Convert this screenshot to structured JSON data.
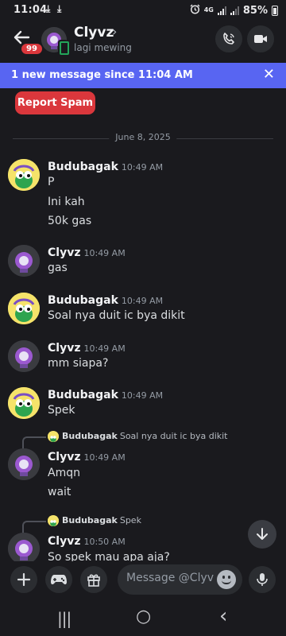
{
  "status": {
    "time": "11:04",
    "downloads": [
      "⤓",
      "⤓"
    ],
    "network": "4G",
    "battery": "85%"
  },
  "header": {
    "back_badge": "99",
    "name": "Clyvz",
    "chevron": "›",
    "subtitle": "lagi mewing",
    "call_icon": "phone-icon",
    "video_icon": "video-icon"
  },
  "banner": {
    "text": "1 new message since 11:04 AM",
    "close": "✕"
  },
  "report_spam": "Report Spam",
  "date_divider": "June 8, 2025",
  "messages": [
    {
      "author": "Budubagak",
      "time": "10:49 AM",
      "lines": [
        "P",
        "Ini kah",
        "50k gas"
      ]
    },
    {
      "author": "Clyvz",
      "time": "10:49 AM",
      "lines": [
        "gas"
      ]
    },
    {
      "author": "Budubagak",
      "time": "10:49 AM",
      "lines": [
        "Soal nya duit ic bya dikit"
      ]
    },
    {
      "author": "Clyvz",
      "time": "10:49 AM",
      "lines": [
        "mm siapa?"
      ]
    },
    {
      "author": "Budubagak",
      "time": "10:49 AM",
      "lines": [
        "Spek"
      ]
    },
    {
      "reply_to": {
        "author": "Budubagak",
        "text": "Soal nya duit ic bya dikit"
      },
      "author": "Clyvz",
      "time": "10:49 AM",
      "lines": [
        "Amqn",
        "wait"
      ]
    },
    {
      "reply_to": {
        "author": "Budubagak",
        "text": "Spek"
      },
      "author": "Clyvz",
      "time": "10:50 AM",
      "lines": [
        "So spek mau apa aja?"
      ]
    }
  ],
  "composer": {
    "placeholder": "Message @Clyvz",
    "icons": [
      "plus-icon",
      "gamepad-icon",
      "gift-icon",
      "emoji-icon",
      "microphone-icon"
    ]
  },
  "navbar": {
    "recents": "|||",
    "home": "○",
    "back": "‹"
  },
  "colors": {
    "background": "#1a1a1e",
    "blurple": "#5865f2",
    "danger": "#da373c",
    "online_green": "#23a55a"
  }
}
